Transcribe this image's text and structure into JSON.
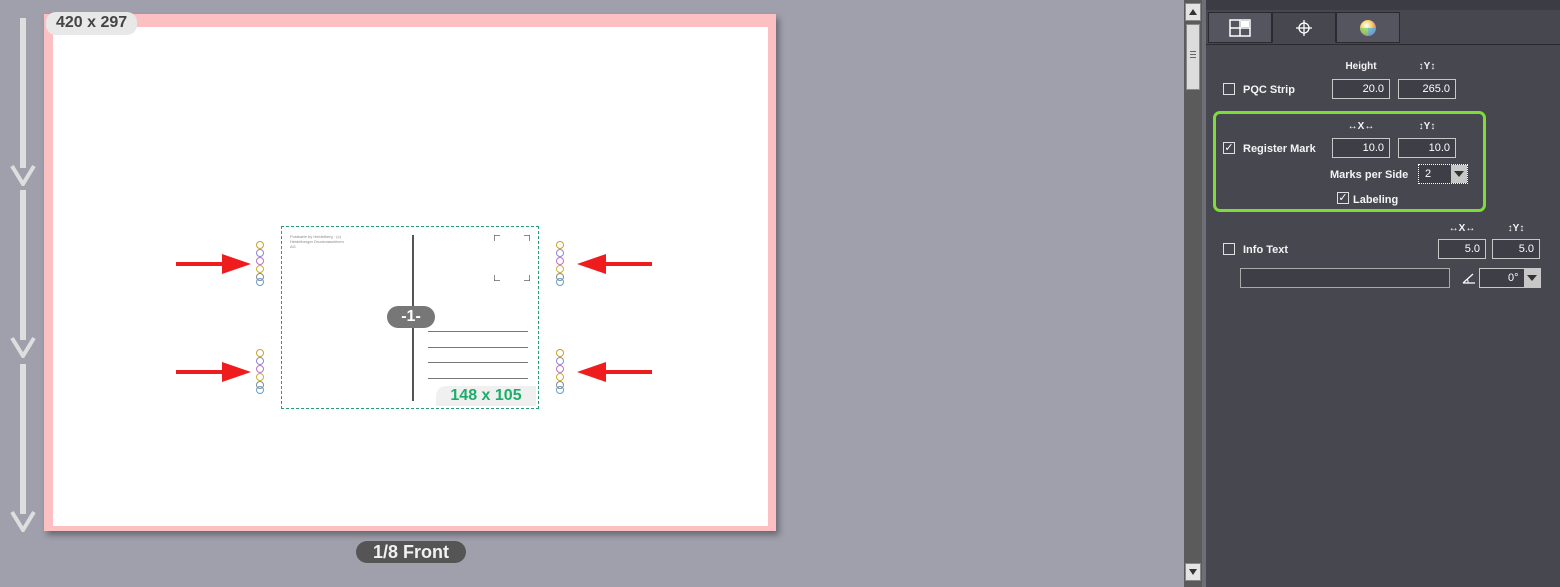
{
  "canvas": {
    "sheet_size": "420 x 297",
    "page_label": "1/8 Front",
    "postcard": {
      "size": "148 x 105",
      "number": "-1-",
      "fine_print": "Postkarte by Heidelberg · (c) Heidelberger Druckmaschinen AG"
    }
  },
  "panel": {
    "tabs": [
      {
        "icon": "layout-grid-icon",
        "active": false
      },
      {
        "icon": "crosshair-icon",
        "active": true
      },
      {
        "icon": "color-wheel-icon",
        "active": false
      }
    ],
    "pqc_strip": {
      "label": "PQC Strip",
      "checked": false,
      "height_header": "Height",
      "y_header": "↕Y↕",
      "height": "20.0",
      "y": "265.0"
    },
    "register_mark": {
      "label": "Register Mark",
      "checked": true,
      "x_header": "↔X↔",
      "y_header": "↕Y↕",
      "x": "10.0",
      "y": "10.0",
      "marks_per_side_label": "Marks per Side",
      "marks_per_side": "2",
      "labeling_label": "Labeling",
      "labeling_checked": true
    },
    "info_text": {
      "label": "Info Text",
      "checked": false,
      "x_header": "↔X↔",
      "y_header": "↕Y↕",
      "x": "5.0",
      "y": "5.0",
      "text": "",
      "angle": "0°"
    }
  },
  "colors": {
    "highlight_box": "#7fdb3a",
    "annotation_arrow": "#ee1c1c",
    "sheet_border": "#fdc0c2"
  }
}
